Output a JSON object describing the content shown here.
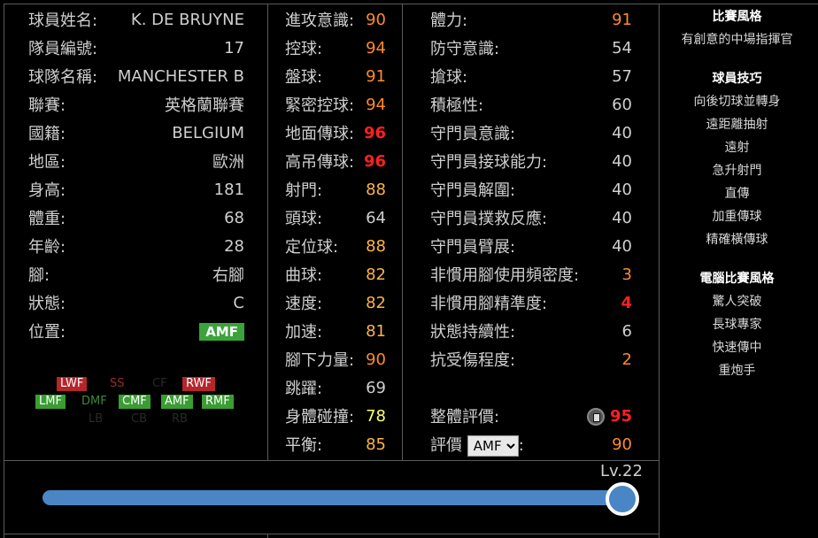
{
  "profile": [
    {
      "label": "球員姓名:",
      "value": "K. DE BRUYNE"
    },
    {
      "label": "隊員編號:",
      "value": "17"
    },
    {
      "label": "球隊名稱:",
      "value": "MANCHESTER B"
    },
    {
      "label": "聯賽:",
      "value": "英格蘭聯賽"
    },
    {
      "label": "國籍:",
      "value": "BELGIUM"
    },
    {
      "label": "地區:",
      "value": "歐洲"
    },
    {
      "label": "身高:",
      "value": "181"
    },
    {
      "label": "體重:",
      "value": "68"
    },
    {
      "label": "年齡:",
      "value": "28"
    },
    {
      "label": "腳:",
      "value": "右腳"
    },
    {
      "label": "狀態:",
      "value": "C"
    },
    {
      "label": "位置:",
      "value": "AMF"
    }
  ],
  "positions": {
    "row1": [
      "LWF",
      "SS",
      "CF",
      "RWF"
    ],
    "row2": [
      "LMF",
      "DMF",
      "CMF",
      "AMF",
      "RMF"
    ],
    "row3": [
      "LB",
      "CB",
      "RB"
    ]
  },
  "stats_a": [
    {
      "label": "進攻意識:",
      "value": "90",
      "color": "#ff8a2a"
    },
    {
      "label": "控球:",
      "value": "94",
      "color": "#ff8a2a"
    },
    {
      "label": "盤球:",
      "value": "91",
      "color": "#ff8a2a"
    },
    {
      "label": "緊密控球:",
      "value": "94",
      "color": "#ff8a2a"
    },
    {
      "label": "地面傳球:",
      "value": "96",
      "color": "#ff2020"
    },
    {
      "label": "高吊傳球:",
      "value": "96",
      "color": "#ff2020"
    },
    {
      "label": "射門:",
      "value": "88",
      "color": "#ffb347"
    },
    {
      "label": "頭球:",
      "value": "64",
      "color": "#cfcfcf"
    },
    {
      "label": "定位球:",
      "value": "88",
      "color": "#ffb347"
    },
    {
      "label": "曲球:",
      "value": "82",
      "color": "#ffb347"
    },
    {
      "label": "速度:",
      "value": "82",
      "color": "#ffb347"
    },
    {
      "label": "加速:",
      "value": "81",
      "color": "#ffb347"
    },
    {
      "label": "腳下力量:",
      "value": "90",
      "color": "#ff8a2a"
    },
    {
      "label": "跳躍:",
      "value": "69",
      "color": "#cfcfcf"
    },
    {
      "label": "身體碰撞:",
      "value": "78",
      "color": "#ffff70"
    },
    {
      "label": "平衡:",
      "value": "85",
      "color": "#ffb347"
    }
  ],
  "stats_b": [
    {
      "label": "體力:",
      "value": "91",
      "color": "#ff8a2a"
    },
    {
      "label": "防守意識:",
      "value": "54",
      "color": "#cfcfcf"
    },
    {
      "label": "搶球:",
      "value": "57",
      "color": "#cfcfcf"
    },
    {
      "label": "積極性:",
      "value": "60",
      "color": "#cfcfcf"
    },
    {
      "label": "守門員意識:",
      "value": "40",
      "color": "#cfcfcf"
    },
    {
      "label": "守門員接球能力:",
      "value": "40",
      "color": "#cfcfcf"
    },
    {
      "label": "守門員解圍:",
      "value": "40",
      "color": "#cfcfcf"
    },
    {
      "label": "守門員撲救反應:",
      "value": "40",
      "color": "#cfcfcf"
    },
    {
      "label": "守門員臂展:",
      "value": "40",
      "color": "#cfcfcf"
    },
    {
      "label": "非慣用腳使用頻密度:",
      "value": "3",
      "color": "#ff8a2a"
    },
    {
      "label": "非慣用腳精準度:",
      "value": "4",
      "color": "#ff2020"
    },
    {
      "label": "狀態持續性:",
      "value": "6",
      "color": "#cfcfcf"
    },
    {
      "label": "抗受傷程度:",
      "value": "2",
      "color": "#ff8a2a"
    }
  ],
  "overall": {
    "label": "整體評價:",
    "value": "95",
    "color": "#ff2020"
  },
  "evaluation": {
    "label": "評價",
    "selected": "AMF",
    "suffix": ":",
    "value": "90",
    "color": "#ff8a2a"
  },
  "right_panel": {
    "play_style_title": "比賽風格",
    "play_style": "有創意的中場指揮官",
    "skills_title": "球員技巧",
    "skills": [
      "向後切球並轉身",
      "遠距離抽射",
      "遠射",
      "急升射門",
      "直傳",
      "加重傳球",
      "精確橫傳球"
    ],
    "ai_title": "電腦比賽風格",
    "ai_styles": [
      "驚人突破",
      "長球專家",
      "快速傳中",
      "重炮手"
    ]
  },
  "level": {
    "label": "Lv.22",
    "fraction": 1.0
  }
}
